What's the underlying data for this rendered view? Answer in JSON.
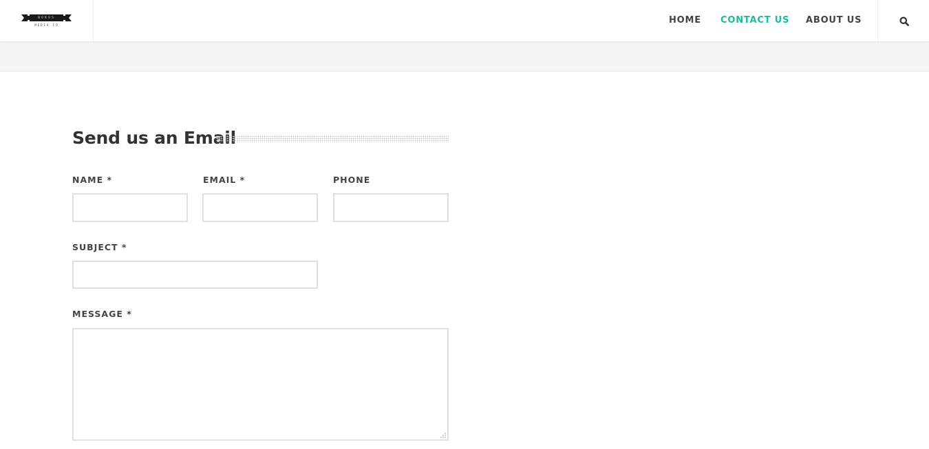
{
  "header": {
    "logo": {
      "text": "NOKOS",
      "subtext": "MEDIA CO",
      "banner_color": "#1a1a1a"
    },
    "nav": [
      {
        "label": "HOME",
        "active": false
      },
      {
        "label": "CONTACT US",
        "active": true
      },
      {
        "label": "ABOUT US",
        "active": false
      }
    ],
    "search_icon": "search-icon",
    "accent_color": "#1abc9c"
  },
  "form": {
    "title": "Send us an Email",
    "name_label": "NAME *",
    "name_value": "",
    "email_label": "EMAIL *",
    "email_value": "",
    "phone_label": "PHONE",
    "phone_value": "",
    "subject_label": "SUBJECT *",
    "subject_value": "",
    "message_label": "MESSAGE *",
    "message_value": ""
  }
}
